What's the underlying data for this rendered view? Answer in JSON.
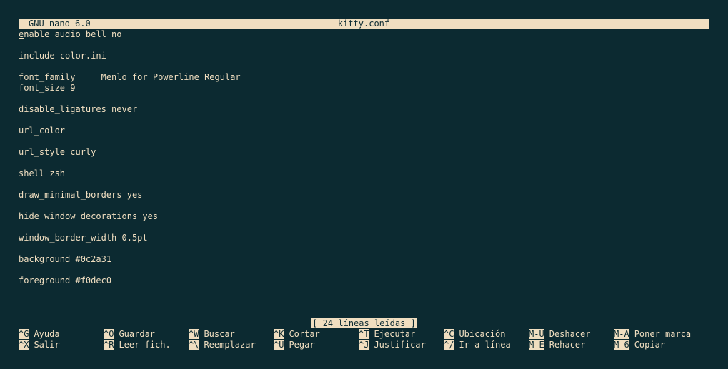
{
  "titlebar": {
    "app": "GNU nano 6.0",
    "file": "kitty.conf"
  },
  "editor": {
    "lines": [
      "enable_audio_bell no",
      "",
      "include color.ini",
      "",
      "font_family     Menlo for Powerline Regular",
      "font_size 9",
      "",
      "disable_ligatures never",
      "",
      "url_color",
      "",
      "url_style curly",
      "",
      "shell zsh",
      "",
      "draw_minimal_borders yes",
      "",
      "hide_window_decorations yes",
      "",
      "window_border_width 0.5pt",
      "",
      "background #0c2a31",
      "",
      "foreground #f0dec0"
    ]
  },
  "status": "[ 24 líneas leídas ]",
  "shortcuts": {
    "row1": [
      {
        "key": "^G",
        "label": "Ayuda",
        "name": "help"
      },
      {
        "key": "^O",
        "label": "Guardar",
        "name": "save"
      },
      {
        "key": "^W",
        "label": "Buscar",
        "name": "search"
      },
      {
        "key": "^K",
        "label": "Cortar",
        "name": "cut"
      },
      {
        "key": "^T",
        "label": "Ejecutar",
        "name": "execute"
      },
      {
        "key": "^C",
        "label": "Ubicación",
        "name": "location"
      },
      {
        "key": "M-U",
        "label": "Deshacer",
        "name": "undo"
      },
      {
        "key": "M-A",
        "label": "Poner marca",
        "name": "set-mark"
      }
    ],
    "row2": [
      {
        "key": "^X",
        "label": "Salir",
        "name": "exit"
      },
      {
        "key": "^R",
        "label": "Leer fich.",
        "name": "read-file"
      },
      {
        "key": "^\\",
        "label": "Reemplazar",
        "name": "replace"
      },
      {
        "key": "^U",
        "label": "Pegar",
        "name": "paste"
      },
      {
        "key": "^J",
        "label": "Justificar",
        "name": "justify"
      },
      {
        "key": "^/",
        "label": "Ir a línea",
        "name": "go-to-line"
      },
      {
        "key": "M-E",
        "label": "Rehacer",
        "name": "redo"
      },
      {
        "key": "M-6",
        "label": "Copiar",
        "name": "copy"
      }
    ]
  }
}
